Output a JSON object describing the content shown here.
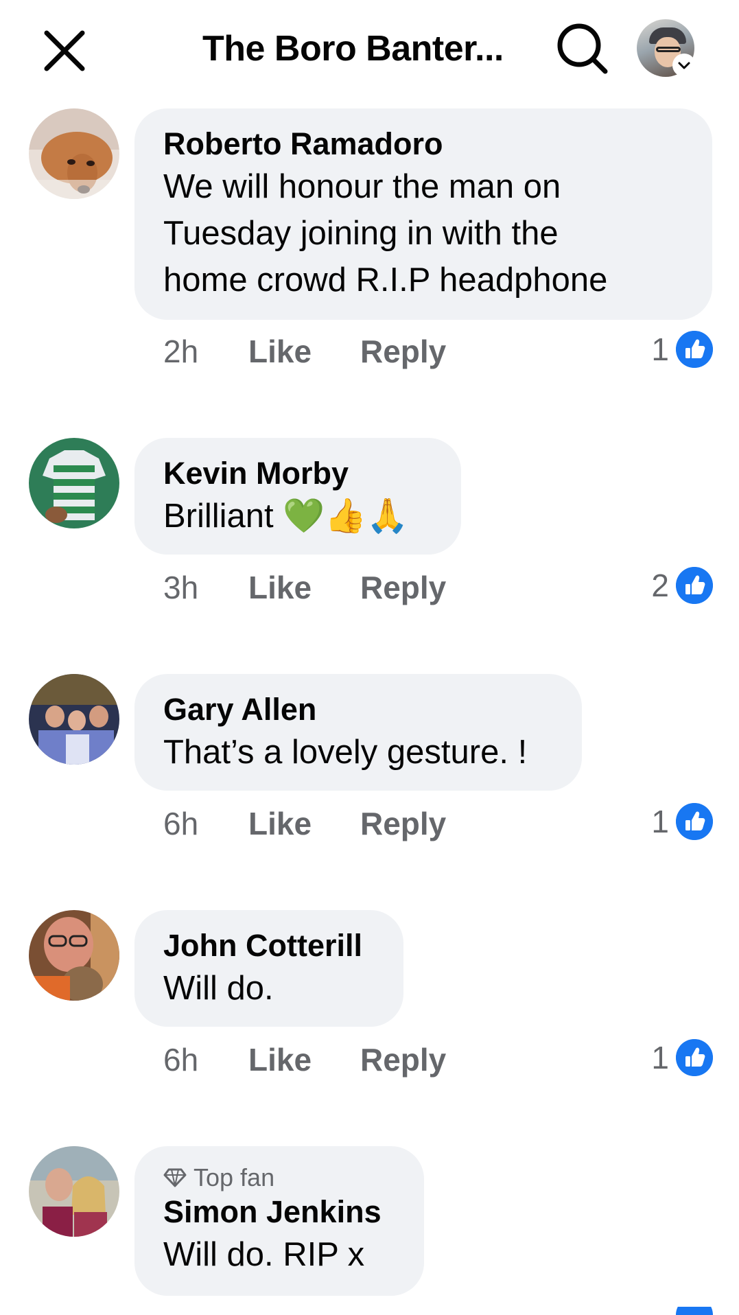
{
  "header": {
    "title": "The Boro Banter...",
    "icons": {
      "close": "close-icon",
      "search": "search-icon",
      "account": "profile-avatar",
      "dropdown": "chevron-down-icon"
    }
  },
  "actions_labels": {
    "like": "Like",
    "reply": "Reply"
  },
  "comments": [
    {
      "author": "Roberto Ramadoro",
      "lines": [
        "We will honour the man on",
        "Tuesday joining in with the",
        "home crowd R.I.P headphone"
      ],
      "time": "2h",
      "reactions": "1"
    },
    {
      "author": "Kevin Morby",
      "text": "Brilliant 💚👍🙏",
      "time": "3h",
      "reactions": "2"
    },
    {
      "author": "Gary Allen",
      "text": "That’s a lovely gesture. !",
      "time": "6h",
      "reactions": "1"
    },
    {
      "author": "John Cotterill",
      "text": "Will do.",
      "time": "6h",
      "reactions": "1"
    },
    {
      "badge": "Top fan",
      "author": "Simon Jenkins",
      "text": "Will do. RIP x"
    }
  ],
  "colors": {
    "bubble": "#f0f2f5",
    "meta_text": "#65676b",
    "like_blue": "#1877f2"
  }
}
